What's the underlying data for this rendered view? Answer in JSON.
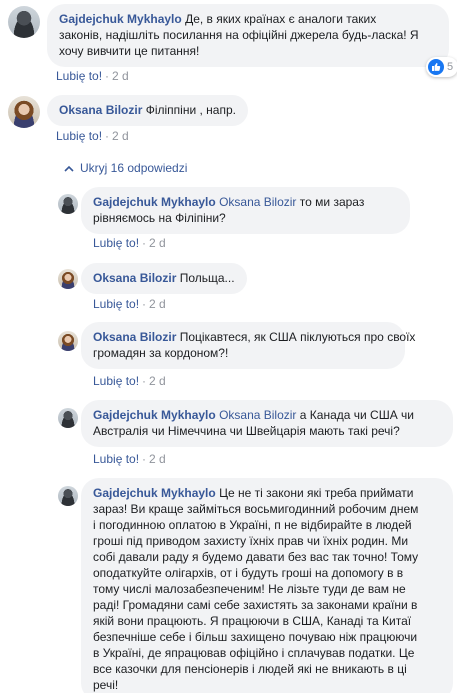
{
  "labels": {
    "like": "Lubię to!",
    "dot": "·"
  },
  "reply_toggle": {
    "label": "Ukryj 16 odpowiedzi"
  },
  "comments": [
    {
      "author": "Gajdejchuk Mykhaylo",
      "mention": "",
      "lines": [
        "Де, в яких країнах є аналоги таких",
        "законів, надішліть посилання на офіційні джерела будь-ласка! Я",
        "хочу вивчити це питання!"
      ],
      "time": "2 d",
      "reactions": "5"
    },
    {
      "author": "Oksana Bilozir",
      "mention": "",
      "lines": [
        "Філіппіни , напр."
      ],
      "time": "2 d"
    }
  ],
  "replies": [
    {
      "author": "Gajdejchuk Mykhaylo",
      "mention": "Oksana Bilozir",
      "lines": [
        "то ми зараз",
        "рівняємось на Філіпіни?"
      ],
      "time": "2 d"
    },
    {
      "author": "Oksana Bilozir",
      "mention": "",
      "lines": [
        "Польща..."
      ],
      "time": "2 d"
    },
    {
      "author": "Oksana Bilozir",
      "mention": "",
      "lines": [
        "Поцікавтеся, як США піклуються про своїх",
        "громадян за кордоном?!"
      ],
      "time": "2 d"
    },
    {
      "author": "Gajdejchuk Mykhaylo",
      "mention": "Oksana Bilozir",
      "lines": [
        "а Канада чи США чи",
        "Австралія чи Німеччина чи Швейцарія мають такі речі?"
      ],
      "time": "2 d"
    },
    {
      "author": "Gajdejchuk Mykhaylo",
      "mention": "",
      "lines": [
        "Це не ті закони які треба приймати",
        "зараз! Ви краще займіться восьмигодинний робочим днем",
        "і погодинною оплатою в Україні, п не відбирайте в людей",
        "гроші під приводом захисту їхніх прав чи їхніх родин. Ми",
        "собі давали раду я будемо давати без вас так точно! Тому",
        "оподаткуйте олігархів, от і будуть гроші на допомогу в в",
        "тому числі малозабезпеченим! Не лізьте туди де вам не",
        "раді! Громадяни самі себе захистять за законами країни в",
        "якій вони працюють. Я працюючи в США, Канаді та Китаї",
        "безпечніше себе і більш захищено почуваю ніж працюючи",
        "в Україні, де япрацював офіційно і сплачував податки. Це",
        "все казочки для пенсіонерів і людей які не вникають в ці",
        "речі!"
      ],
      "time": ""
    }
  ],
  "colors": {
    "name": "#385898",
    "bubble": "#f2f3f5",
    "meta": "#90949c",
    "like_icon": "#1877f2"
  }
}
